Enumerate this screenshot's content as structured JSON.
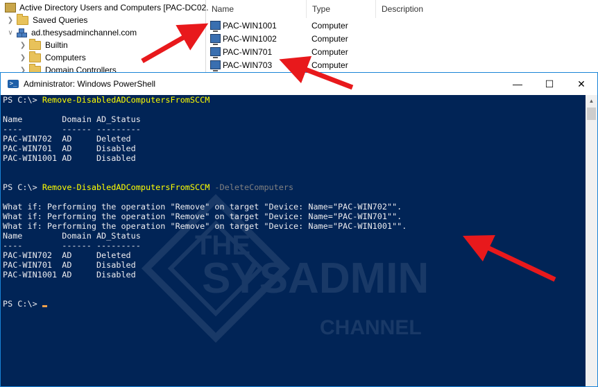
{
  "aduc": {
    "title": "Active Directory Users and Computers [PAC-DC02.",
    "tree": [
      {
        "label": "Saved Queries"
      },
      {
        "label": "ad.thesysadminchannel.com"
      },
      {
        "label": "Builtin"
      },
      {
        "label": "Computers"
      },
      {
        "label": "Domain Controllers"
      }
    ],
    "columns": {
      "name": "Name",
      "type": "Type",
      "description": "Description"
    },
    "rows": [
      {
        "name": "PAC-WIN1001",
        "type": "Computer"
      },
      {
        "name": "PAC-WIN1002",
        "type": "Computer"
      },
      {
        "name": "PAC-WIN701",
        "type": "Computer"
      },
      {
        "name": "PAC-WIN703",
        "type": "Computer"
      }
    ]
  },
  "powershell": {
    "title": "Administrator: Windows PowerShell",
    "prompt": "PS C:\\> ",
    "command1": "Remove-DisabledADComputersFromSCCM",
    "header": "Name        Domain AD_Status",
    "separator": "----        ------ ---------",
    "results1": [
      "PAC-WIN702  AD     Deleted",
      "PAC-WIN701  AD     Disabled",
      "PAC-WIN1001 AD     Disabled"
    ],
    "command2": "Remove-DisabledADComputersFromSCCM",
    "param2": " -DeleteComputers",
    "whatif": [
      "What if: Performing the operation \"Remove\" on target \"Device: Name=\"PAC-WIN702\"\".",
      "What if: Performing the operation \"Remove\" on target \"Device: Name=\"PAC-WIN701\"\".",
      "What if: Performing the operation \"Remove\" on target \"Device: Name=\"PAC-WIN1001\"\"."
    ],
    "results2": [
      "PAC-WIN702  AD     Deleted",
      "PAC-WIN701  AD     Disabled",
      "PAC-WIN1001 AD     Disabled"
    ]
  },
  "watermark": {
    "line1": "THE",
    "line2": "SYSADMIN",
    "line3": "CHANNEL"
  },
  "colors": {
    "console_bg": "#012456",
    "command": "#ffff00",
    "parameter": "#808080",
    "arrow": "#e8191c",
    "cursor": "#f7a24b"
  }
}
